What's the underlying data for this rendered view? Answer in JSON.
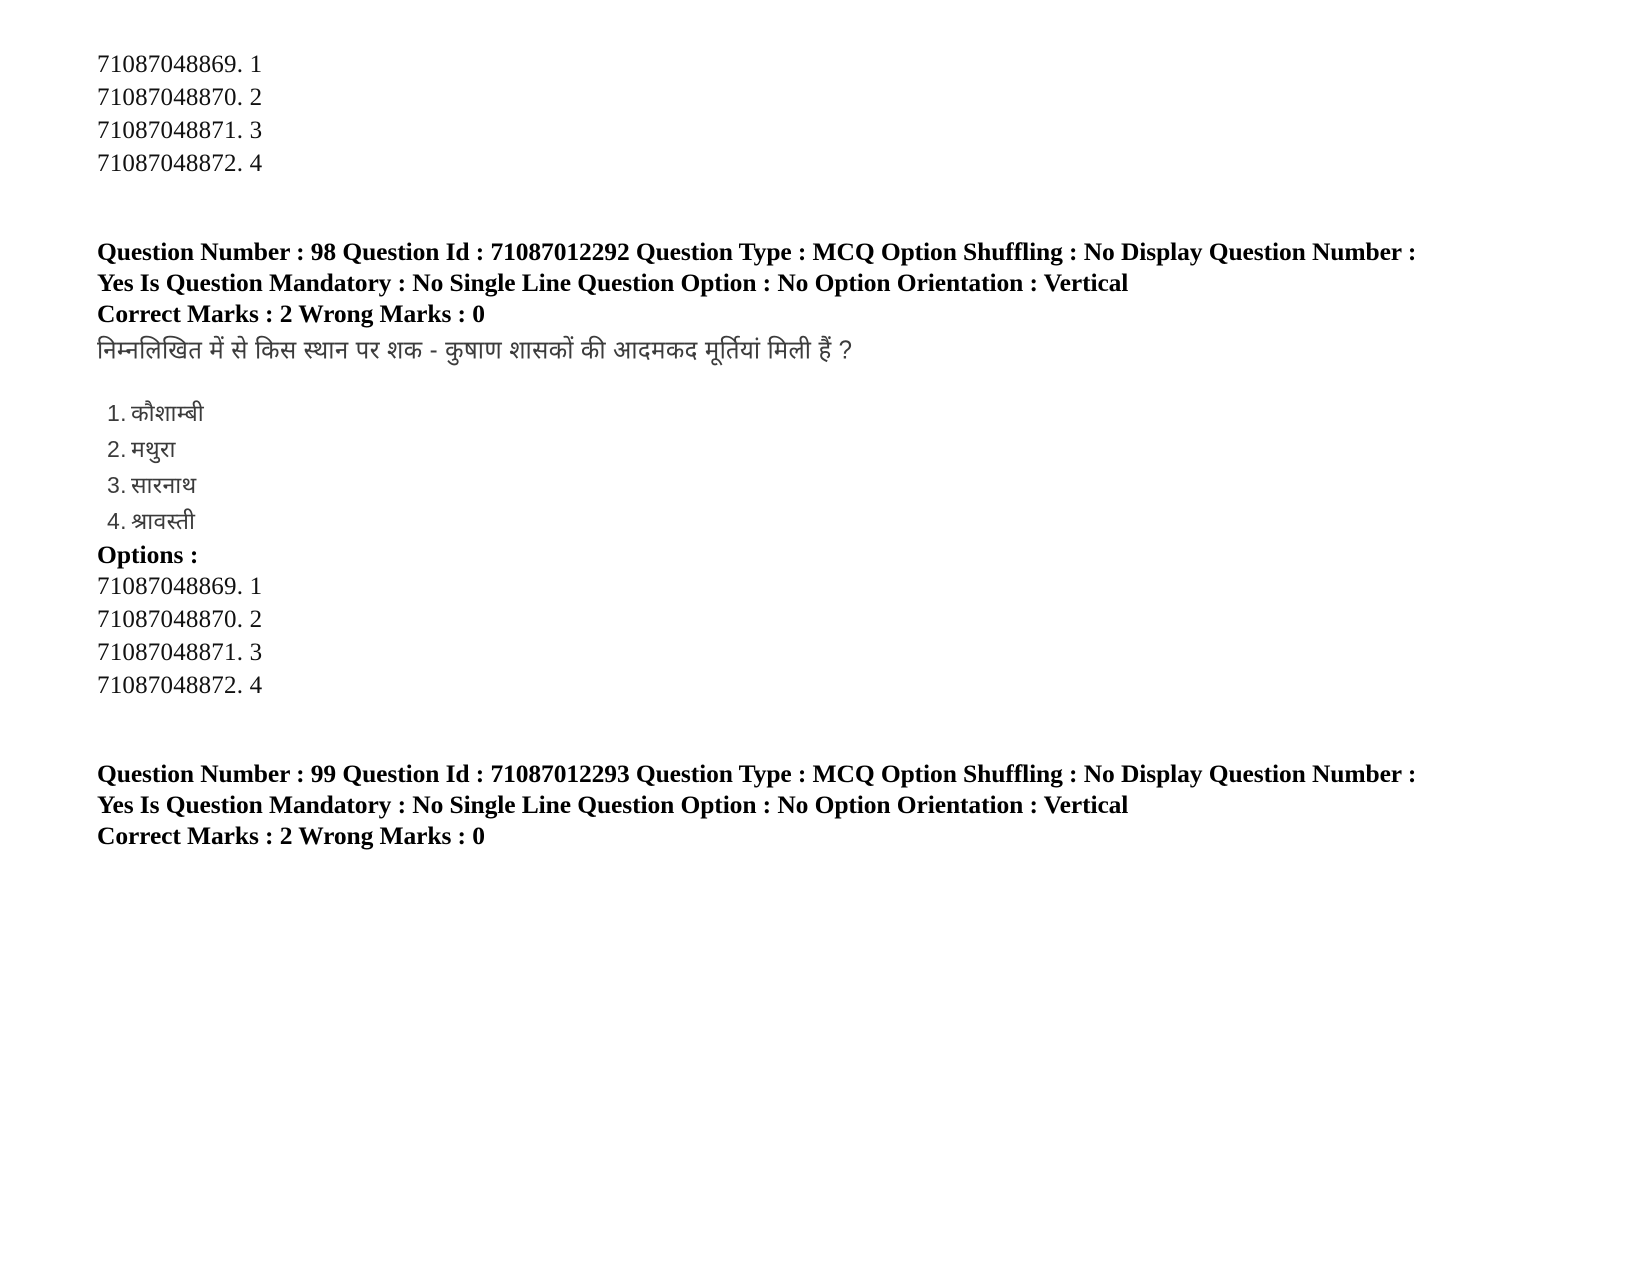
{
  "document": {
    "background_color": "#ffffff",
    "text_color": "#000000"
  },
  "top_option_ids": [
    "71087048869. 1",
    "71087048870. 2",
    "71087048871. 3",
    "71087048872. 4"
  ],
  "question_98": {
    "meta_line_1": "Question Number : 98 Question Id : 71087012292 Question Type : MCQ Option Shuffling : No Display Question Number : Yes Is Question Mandatory : No Single Line Question Option : No Option Orientation : Vertical",
    "meta_line_2": "Correct Marks : 2 Wrong Marks : 0",
    "question_text": "निम्नलिखित में से किस स्थान पर शक - कुषाण शासकों की आदमकद मूर्तियां मिली हैं ?",
    "choices": [
      {
        "number": "1.",
        "text": "कौशाम्बी"
      },
      {
        "number": "2.",
        "text": "मथुरा"
      },
      {
        "number": "3.",
        "text": "सारनाथ"
      },
      {
        "number": "4.",
        "text": "श्रावस्ती"
      }
    ],
    "options_label": "Options :",
    "option_ids": [
      "71087048869. 1",
      "71087048870. 2",
      "71087048871. 3",
      "71087048872. 4"
    ]
  },
  "question_99": {
    "meta_line_1": "Question Number : 99 Question Id : 71087012293 Question Type : MCQ Option Shuffling : No Display Question Number : Yes Is Question Mandatory : No Single Line Question Option : No Option Orientation : Vertical",
    "meta_line_2": "Correct Marks : 2 Wrong Marks : 0"
  }
}
